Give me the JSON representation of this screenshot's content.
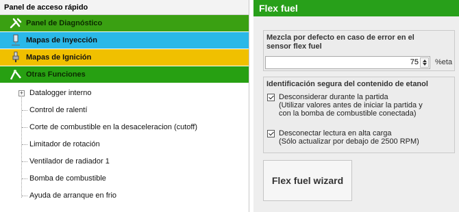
{
  "left": {
    "title": "Panel de acceso rápido",
    "categories": [
      {
        "label": "Panel de Diagnóstico",
        "icon": "wrench-icon",
        "color": "#3aa012"
      },
      {
        "label": "Mapas de Inyección",
        "icon": "injector-icon",
        "color": "#2ab8e8"
      },
      {
        "label": "Mapas de Ignición",
        "icon": "spark-plug-icon",
        "color": "#f0c000"
      },
      {
        "label": "Otras Funciones",
        "icon": "functions-icon",
        "color": "#27a012"
      }
    ],
    "tree_items": [
      "Datalogger interno",
      "Control de ralentí",
      "Corte de combustible en la desaceleracion (cutoff)",
      "Limitador de rotación",
      "Ventilador de radiador 1",
      "Bomba de combustible",
      "Ayuda de arranque en frio"
    ],
    "expander": "+"
  },
  "right": {
    "header": "Flex fuel",
    "header_color": "#28a01a",
    "default_mix": {
      "title_line1": "Mezcla por defecto en caso de error en el",
      "title_line2": "sensor flex fuel",
      "value": "75",
      "unit": "%eta"
    },
    "ethanol_id": {
      "title": "Identificación segura del contenido de etanol",
      "option1": {
        "checked": true,
        "line1": "Desconsiderar durante la partida",
        "line2": "(Utilizar valores antes de iniciar la partida y",
        "line3": "con la bomba de combustible conectada)"
      },
      "option2": {
        "checked": true,
        "line1": "Desconectar lectura en alta carga",
        "line2": "(Sólo actualizar por debajo de 2500 RPM)"
      }
    },
    "wizard_label": "Flex fuel wizard"
  }
}
